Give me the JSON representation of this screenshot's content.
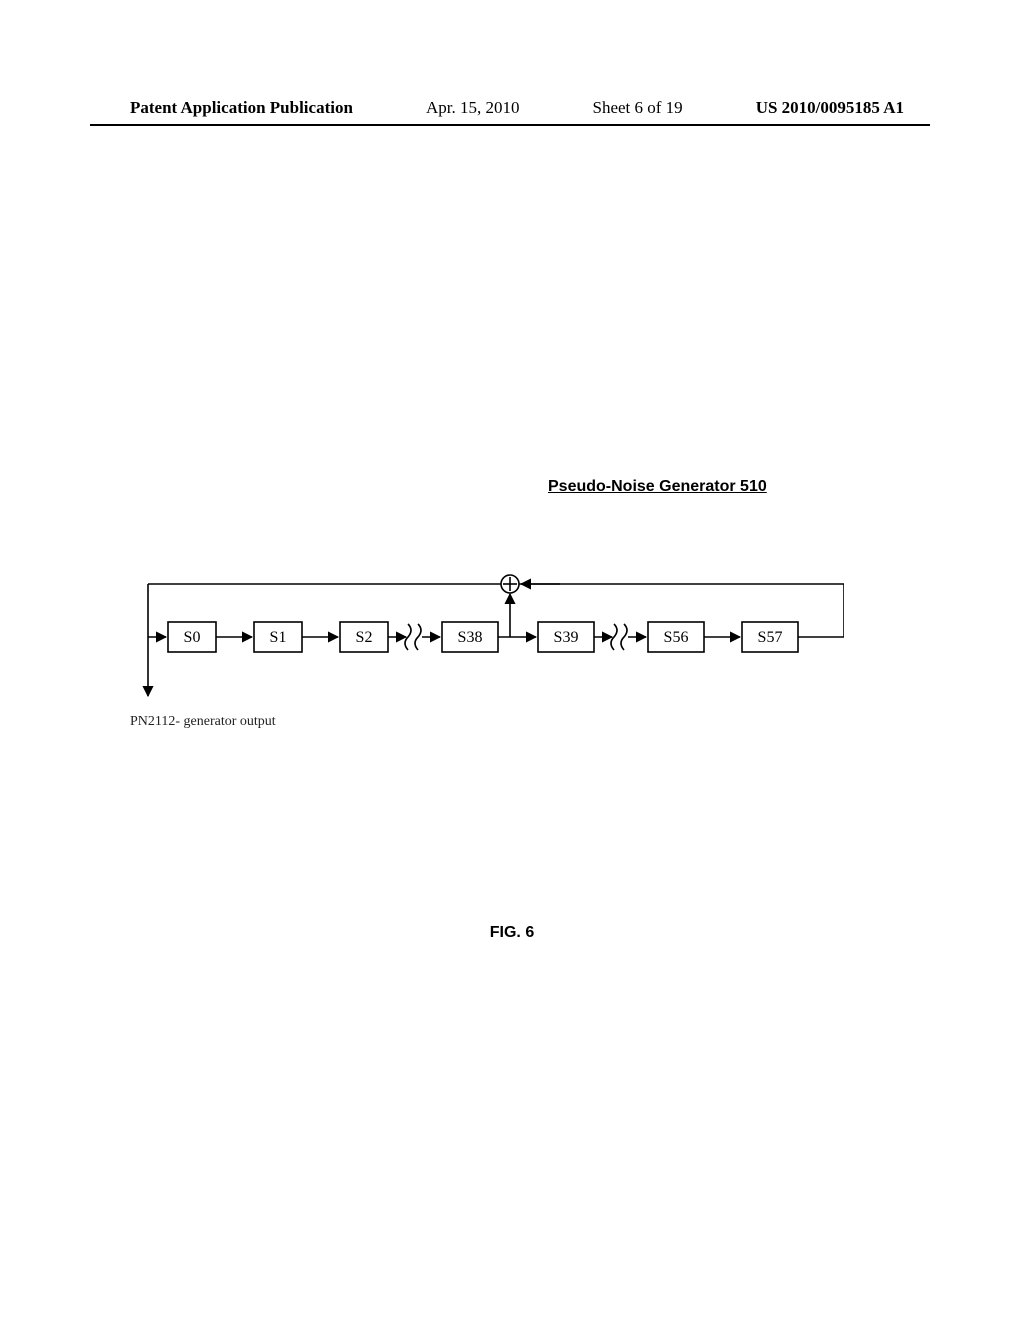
{
  "header": {
    "publication": "Patent Application Publication",
    "date": "Apr. 15, 2010",
    "sheet": "Sheet 6 of 19",
    "docnum": "US 2010/0095185 A1"
  },
  "component_title": "Pseudo-Noise Generator 510",
  "output_label": "PN2112- generator output",
  "figure_label": "FIG. 6",
  "diagram": {
    "registers": [
      "S0",
      "S1",
      "S2",
      "S38",
      "S39",
      "S56",
      "S57"
    ],
    "break_after_indices": [
      2,
      4
    ],
    "tap_after_index": 3,
    "feedback_from_last": true,
    "output_from_first": true,
    "operator": "xor"
  }
}
